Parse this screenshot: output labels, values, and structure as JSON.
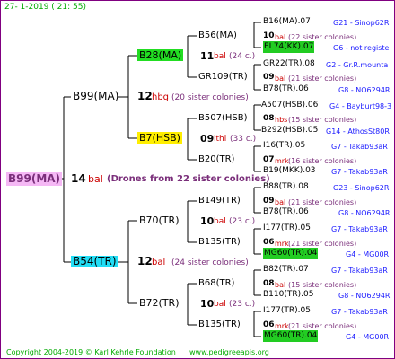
{
  "header": {
    "timestamp": "27-   1-2019 (  21:  55)"
  },
  "root": {
    "name": "B99(MA)",
    "number": "14",
    "code": "bal",
    "note": "(Drones from 22 sister colonies)"
  },
  "gen2": [
    {
      "name": "B99(MA)",
      "number": "12",
      "code": "hbg",
      "note": "(20 sister colonies)"
    },
    {
      "name": "B54(TR)",
      "number": "12",
      "code": "bal",
      "note": "(24 sister colonies)"
    }
  ],
  "gen3": [
    {
      "name": "B28(MA)",
      "number": "11",
      "code": "bal",
      "note": "(24 c.)"
    },
    {
      "name": "B7(HSB)",
      "number": "09",
      "code": "lthl",
      "note": "(33 c.)"
    },
    {
      "name": "B70(TR)",
      "number": "10",
      "code": "bal",
      "note": "(23 c.)"
    },
    {
      "name": "B72(TR)",
      "number": "10",
      "code": "bal",
      "note": "(23 c.)"
    }
  ],
  "gen4": [
    {
      "name": "B56(MA)",
      "number": "10",
      "code": "bal",
      "note": "(22 sister colonies)"
    },
    {
      "name": "GR109(TR)",
      "number": "09",
      "code": "bal",
      "note": "(21 sister colonies)"
    },
    {
      "name": "B507(HSB)",
      "number": "08",
      "code": "hbs",
      "note": "(15 sister colonies)"
    },
    {
      "name": "B20(TR)",
      "number": "07",
      "code": "mrk",
      "note": "(16 sister colonies)"
    },
    {
      "name": "B149(TR)",
      "number": "09",
      "code": "bal",
      "note": "(21 sister colonies)"
    },
    {
      "name": "B135(TR)",
      "number": "06",
      "code": "mrk",
      "note": "(21 sister colonies)"
    },
    {
      "name": "B68(TR)",
      "number": "08",
      "code": "bal",
      "note": "(15 sister colonies)"
    },
    {
      "name": "B135(TR)",
      "number": "06",
      "code": "mrk",
      "note": "(21 sister colonies)"
    }
  ],
  "gen5": [
    {
      "name": "B16(MA).07",
      "source": "G21 - Sinop62R"
    },
    {
      "name": "EL74(KK).07",
      "source": "G6 - not registe"
    },
    {
      "name": "GR22(TR).08",
      "source": "G2 - Gr.R.mounta"
    },
    {
      "name": "B78(TR).06",
      "source": "G8 - NO6294R"
    },
    {
      "name": "A507(HSB).06",
      "source": "G4 - Bayburt98-3"
    },
    {
      "name": "B292(HSB).05",
      "source": "G14 - AthosSt80R"
    },
    {
      "name": "I16(TR).05",
      "source": "G7 - Takab93aR"
    },
    {
      "name": "B19(MKK).03",
      "source": "G7 - Takab93aR"
    },
    {
      "name": "B88(TR).08",
      "source": "G23 - Sinop62R"
    },
    {
      "name": "B78(TR).06",
      "source": "G8 - NO6294R"
    },
    {
      "name": "I177(TR).05",
      "source": "G7 - Takab93aR"
    },
    {
      "name": "MG60(TR).04",
      "source": "G4 - MG00R"
    },
    {
      "name": "B82(TR).07",
      "source": "G7 - Takab93aR"
    },
    {
      "name": "B110(TR).05",
      "source": "G8 - NO6294R"
    },
    {
      "name": "I177(TR).05",
      "source": "G7 - Takab93aR"
    },
    {
      "name": "MG60(TR).04",
      "source": "G4 - MG00R"
    }
  ],
  "footer": {
    "copyright": "Copyright 2004-2019 © Karl Kehrle Foundation",
    "url": "www.pedigreeapis.org"
  }
}
